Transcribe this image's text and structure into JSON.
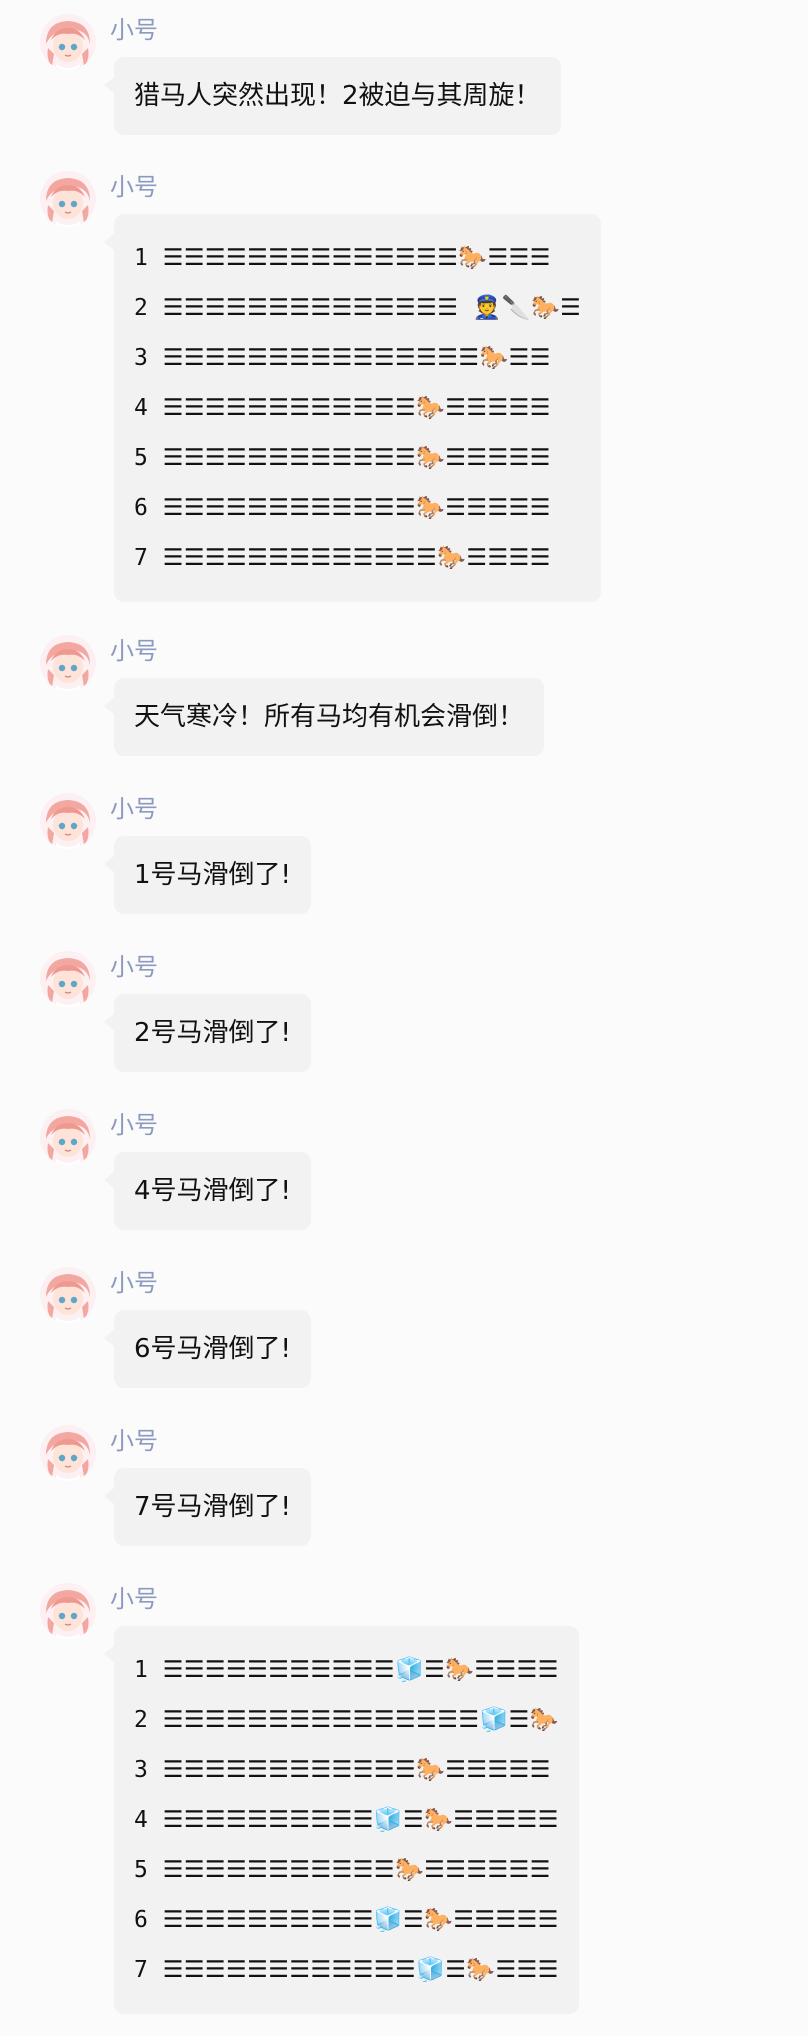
{
  "sender_name": "小号",
  "messages": [
    {
      "type": "text",
      "text": "猎马人突然出现！2被迫与其周旋！"
    },
    {
      "type": "race",
      "lines": [
        "1 ☰☰☰☰☰☰☰☰☰☰☰☰☰☰🐎☰☰☰",
        "2 ☰☰☰☰☰☰☰☰☰☰☰☰☰☰ 👮🔪🐎☰",
        "3 ☰☰☰☰☰☰☰☰☰☰☰☰☰☰☰🐎☰☰",
        "4 ☰☰☰☰☰☰☰☰☰☰☰☰🐎☰☰☰☰☰",
        "5 ☰☰☰☰☰☰☰☰☰☰☰☰🐎☰☰☰☰☰",
        "6 ☰☰☰☰☰☰☰☰☰☰☰☰🐎☰☰☰☰☰",
        "7 ☰☰☰☰☰☰☰☰☰☰☰☰☰🐎☰☰☰☰"
      ]
    },
    {
      "type": "text",
      "text": "天气寒冷！所有马均有机会滑倒！"
    },
    {
      "type": "text",
      "text": "1号马滑倒了!"
    },
    {
      "type": "text",
      "text": "2号马滑倒了!"
    },
    {
      "type": "text",
      "text": "4号马滑倒了!"
    },
    {
      "type": "text",
      "text": "6号马滑倒了!"
    },
    {
      "type": "text",
      "text": "7号马滑倒了!"
    },
    {
      "type": "race",
      "lines": [
        "1 ☰☰☰☰☰☰☰☰☰☰☰🧊☰🐎☰☰☰☰",
        "2 ☰☰☰☰☰☰☰☰☰☰☰☰☰☰☰🧊☰🐎",
        "3 ☰☰☰☰☰☰☰☰☰☰☰☰🐎☰☰☰☰☰",
        "4 ☰☰☰☰☰☰☰☰☰☰🧊☰🐎☰☰☰☰☰",
        "5 ☰☰☰☰☰☰☰☰☰☰☰🐎☰☰☰☰☰☰",
        "6 ☰☰☰☰☰☰☰☰☰☰🧊☰🐎☰☰☰☰☰",
        "7 ☰☰☰☰☰☰☰☰☰☰☰☰🧊☰🐎☰☰☰"
      ]
    }
  ]
}
